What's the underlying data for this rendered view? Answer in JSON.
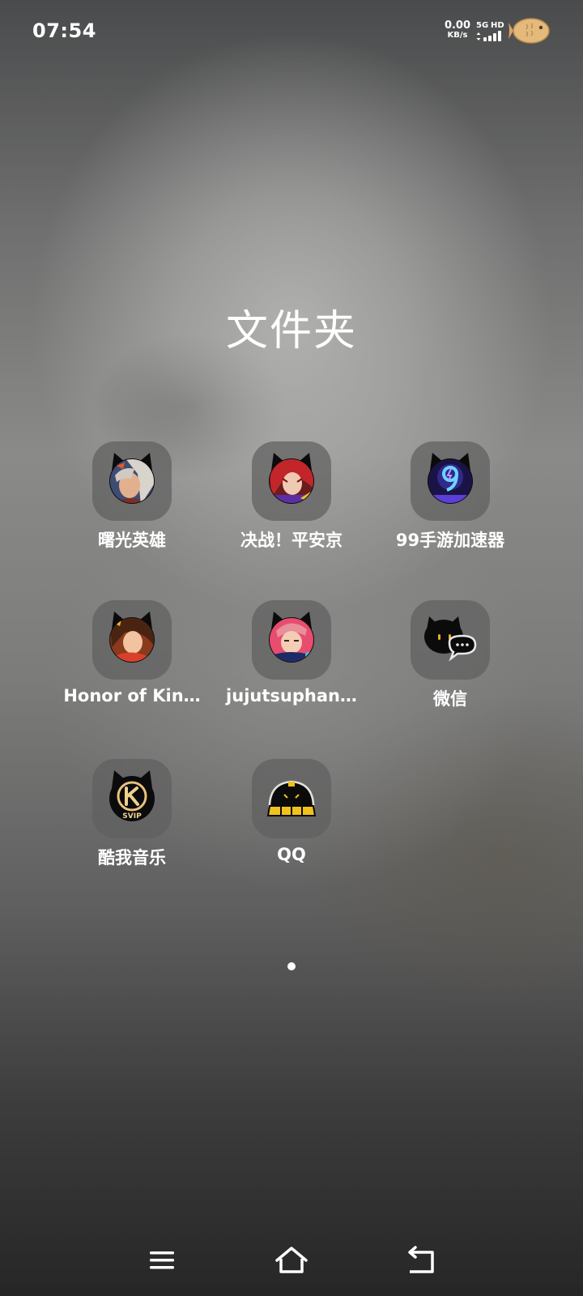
{
  "status_bar": {
    "time": "07:54",
    "net_speed_value": "0.00",
    "net_speed_unit": "KB/s",
    "network_type": "5G",
    "hd_label": "HD",
    "signal_level": 0.75,
    "icons": [
      "signal-icon",
      "fish-icon"
    ]
  },
  "folder": {
    "title": "文件夹",
    "apps": [
      {
        "label": "曙光英雄",
        "icon": "shuguang-hero-app-icon"
      },
      {
        "label": "决战！平安京",
        "icon": "onmyoji-arena-app-icon"
      },
      {
        "label": "99手游加速器",
        "icon": "accelerator-99-app-icon"
      },
      {
        "label": "Honor of Kin…",
        "icon": "honor-of-kings-app-icon"
      },
      {
        "label": "jujutsuphan…",
        "icon": "jujutsu-phantom-app-icon"
      },
      {
        "label": "微信",
        "icon": "wechat-app-icon"
      },
      {
        "label": "酷我音乐",
        "icon": "kuwo-music-app-icon"
      },
      {
        "label": "QQ",
        "icon": "qq-app-icon"
      }
    ]
  },
  "pager": {
    "current_page": 1,
    "total_pages": 1
  },
  "nav_bar": {
    "buttons": [
      "menu-icon",
      "home-icon",
      "back-icon"
    ]
  },
  "colors": {
    "text": "#ffffff",
    "tile": "#606060",
    "badge_cat": "#0b0b0c"
  }
}
